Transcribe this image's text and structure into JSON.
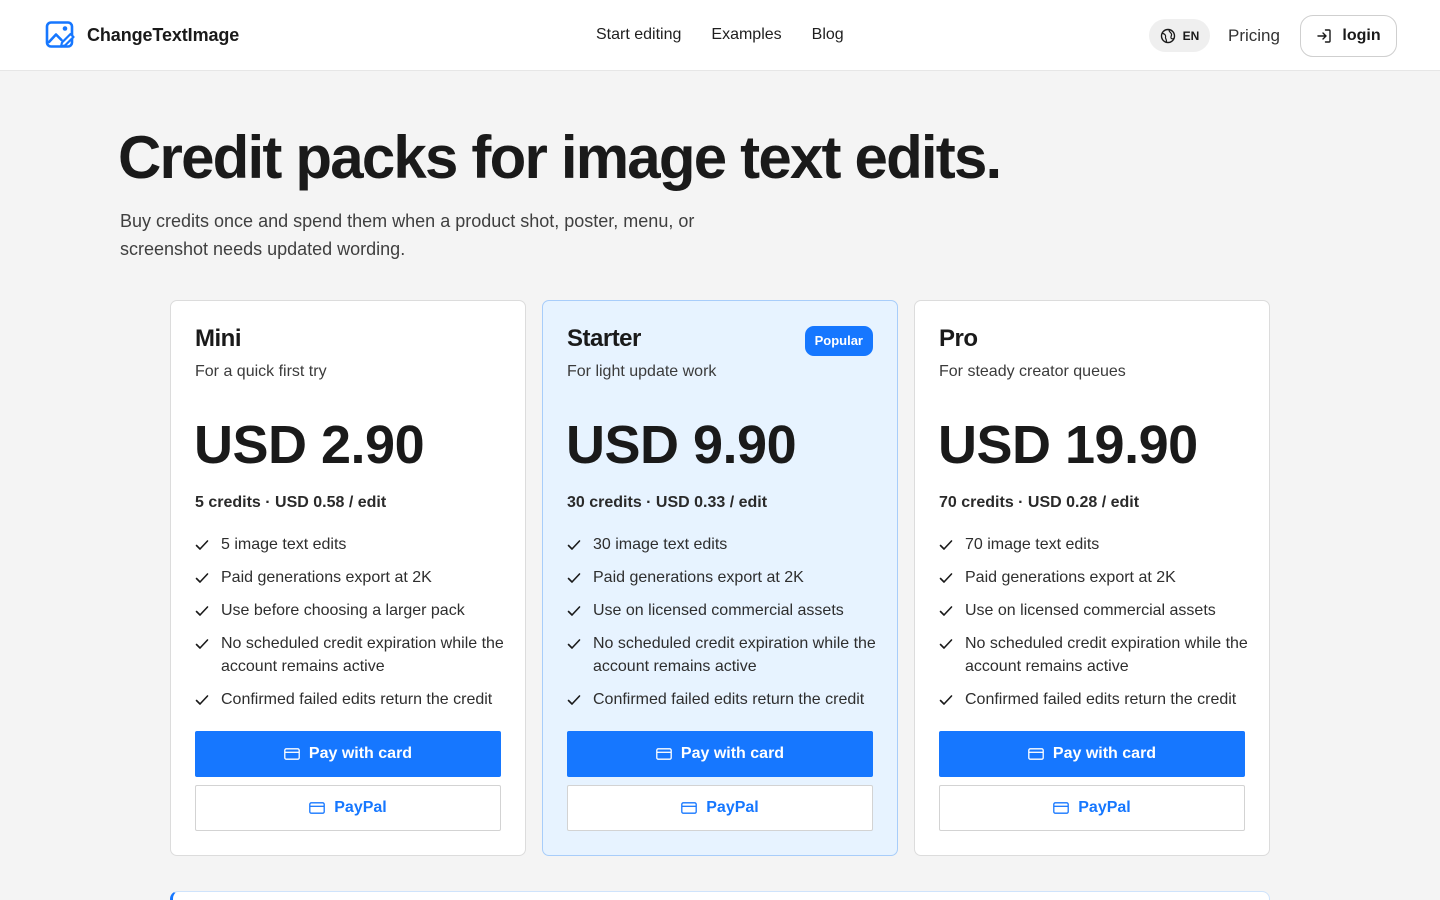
{
  "header": {
    "brand": "ChangeTextImage",
    "nav": [
      "Start editing",
      "Examples",
      "Blog"
    ],
    "language": "EN",
    "pricing": "Pricing",
    "login": "login"
  },
  "hero": {
    "title": "Credit packs for image text edits.",
    "subtitle": "Buy credits once and spend them when a product shot, poster, menu, or screenshot needs updated wording."
  },
  "plans": [
    {
      "name": "Mini",
      "tagline": "For a quick first try",
      "price": "USD 2.90",
      "credits": "5 credits · USD 0.58 / edit",
      "features": [
        "5 image text edits",
        "Paid generations export at 2K",
        "Use before choosing a larger pack",
        "No scheduled credit expiration while the account remains active",
        "Confirmed failed edits return the credit"
      ],
      "pay_card": "Pay with card",
      "pay_paypal": "PayPal"
    },
    {
      "name": "Starter",
      "badge": "Popular",
      "tagline": "For light update work",
      "price": "USD 9.90",
      "credits": "30 credits · USD 0.33 / edit",
      "features": [
        "30 image text edits",
        "Paid generations export at 2K",
        "Use on licensed commercial assets",
        "No scheduled credit expiration while the account remains active",
        "Confirmed failed edits return the credit"
      ],
      "pay_card": "Pay with card",
      "pay_paypal": "PayPal"
    },
    {
      "name": "Pro",
      "tagline": "For steady creator queues",
      "price": "USD 19.90",
      "credits": "70 credits · USD 0.28 / edit",
      "features": [
        "70 image text edits",
        "Paid generations export at 2K",
        "Use on licensed commercial assets",
        "No scheduled credit expiration while the account remains active",
        "Confirmed failed edits return the credit"
      ],
      "pay_card": "Pay with card",
      "pay_paypal": "PayPal"
    }
  ],
  "colors": {
    "accent": "#1677ff",
    "featured_bg": "#e7f3ff",
    "page_bg": "#f4f4f4"
  },
  "icons": {
    "brand": "image-edit-icon",
    "language": "globe-icon",
    "login": "login-arrow-icon",
    "feature": "check-icon",
    "card": "credit-card-icon"
  }
}
